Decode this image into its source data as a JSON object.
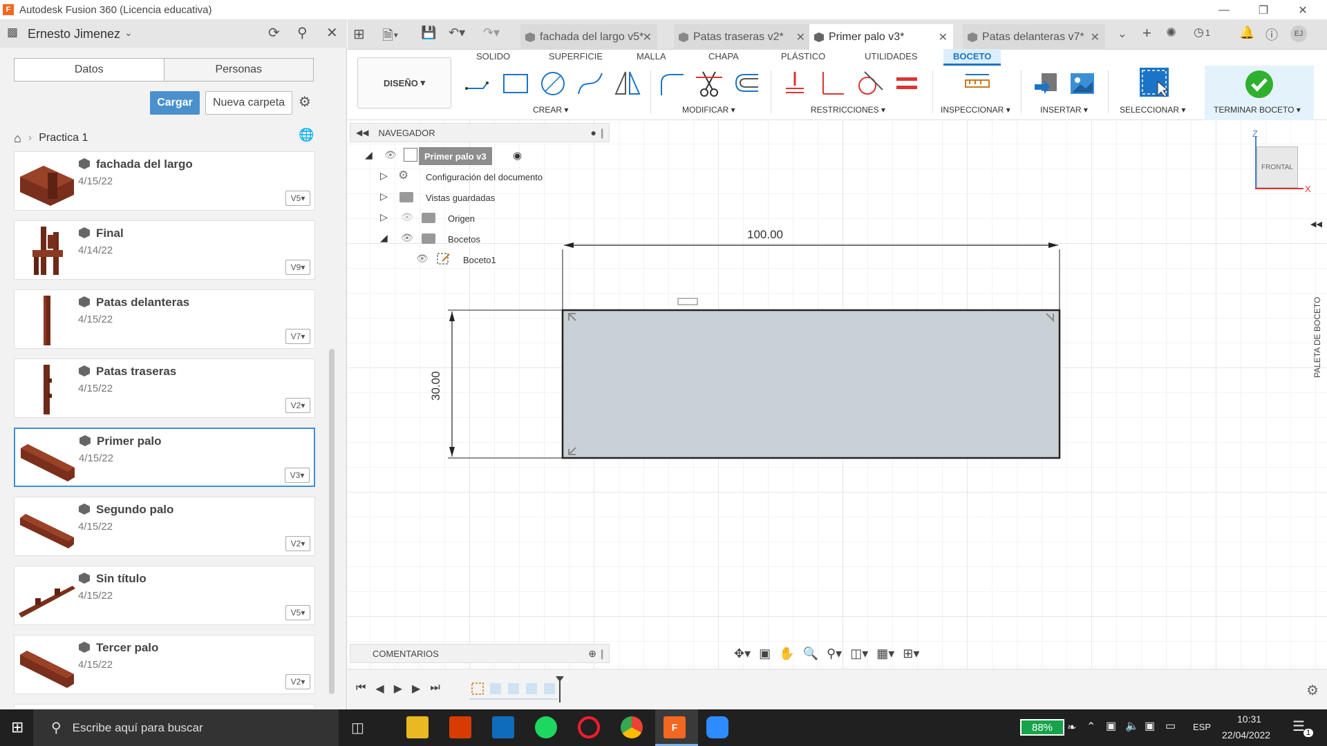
{
  "window": {
    "title": "Autodesk Fusion 360 (Licencia educativa)",
    "app_letter": "F"
  },
  "leftpanel": {
    "user": "Ernesto Jimenez",
    "tabs": [
      "Datos",
      "Personas"
    ],
    "upload": "Cargar",
    "new_folder": "Nueva carpeta",
    "breadcrumb": "Practica 1",
    "items": [
      {
        "name": "fachada del largo",
        "date": "4/15/22",
        "version": "V5"
      },
      {
        "name": "Final",
        "date": "4/14/22",
        "version": "V9"
      },
      {
        "name": "Patas delanteras",
        "date": "4/15/22",
        "version": "V7"
      },
      {
        "name": "Patas traseras",
        "date": "4/15/22",
        "version": "V2"
      },
      {
        "name": "Primer palo",
        "date": "4/15/22",
        "version": "V3"
      },
      {
        "name": "Segundo palo",
        "date": "4/15/22",
        "version": "V2"
      },
      {
        "name": "Sin título",
        "date": "4/15/22",
        "version": "V5"
      },
      {
        "name": "Tercer palo",
        "date": "4/15/22",
        "version": "V2"
      }
    ]
  },
  "doctabs": [
    {
      "label": "fachada del largo v5*"
    },
    {
      "label": "Patas traseras v2*"
    },
    {
      "label": "Primer palo v3*"
    },
    {
      "label": "Patas delanteras v7*"
    }
  ],
  "topbar": {
    "jobs_count": "1",
    "user_initials": "EJ"
  },
  "ribbon": {
    "workspace": "DISEÑO",
    "tabs": [
      "SOLIDO",
      "SUPERFICIE",
      "MALLA",
      "CHAPA",
      "PLÁSTICO",
      "UTILIDADES",
      "BOCETO"
    ],
    "groups": [
      "CREAR",
      "MODIFICAR",
      "RESTRICCIONES",
      "INSPECCIONAR",
      "INSERTAR",
      "SELECCIONAR",
      "TERMINAR BOCETO"
    ]
  },
  "browser": {
    "title": "NAVEGADOR",
    "root": "Primer palo v3",
    "rows": [
      "Configuración del documento",
      "Vistas guardadas",
      "Origen",
      "Bocetos",
      "Boceto1"
    ],
    "comments": "COMENTARIOS"
  },
  "sketch": {
    "width": "100.00",
    "height": "30.00"
  },
  "viewcube": {
    "face": "FRONTAL",
    "axis_z": "Z",
    "axis_x": "X"
  },
  "sketch_palette": "PALETA DE BOCETO",
  "taskbar": {
    "search": "Escribe aquí para buscar",
    "battery": "88%",
    "lang": "ESP",
    "time": "10:31",
    "date": "22/04/2022",
    "notifications": "1"
  },
  "colors": {
    "accent": "#1b74c6",
    "upload_button": "#4a90cd",
    "wood": "#7a2f1c",
    "sketch_fill": "#c9d1d7",
    "finish_green": "#2fb02f"
  }
}
